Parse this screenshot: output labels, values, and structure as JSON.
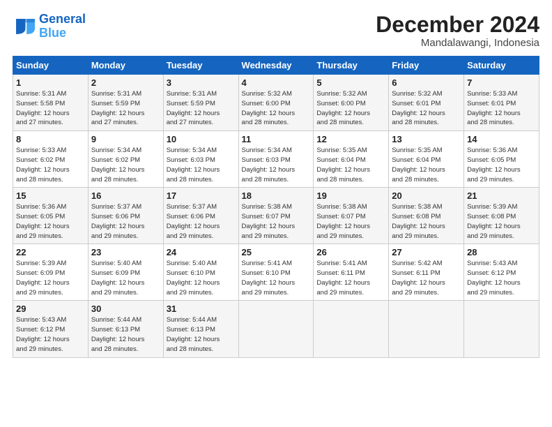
{
  "logo": {
    "line1": "General",
    "line2": "Blue"
  },
  "title": "December 2024",
  "location": "Mandalawangi, Indonesia",
  "days_header": [
    "Sunday",
    "Monday",
    "Tuesday",
    "Wednesday",
    "Thursday",
    "Friday",
    "Saturday"
  ],
  "weeks": [
    [
      {
        "num": "1",
        "info": "Sunrise: 5:31 AM\nSunset: 5:58 PM\nDaylight: 12 hours\nand 27 minutes."
      },
      {
        "num": "2",
        "info": "Sunrise: 5:31 AM\nSunset: 5:59 PM\nDaylight: 12 hours\nand 27 minutes."
      },
      {
        "num": "3",
        "info": "Sunrise: 5:31 AM\nSunset: 5:59 PM\nDaylight: 12 hours\nand 27 minutes."
      },
      {
        "num": "4",
        "info": "Sunrise: 5:32 AM\nSunset: 6:00 PM\nDaylight: 12 hours\nand 28 minutes."
      },
      {
        "num": "5",
        "info": "Sunrise: 5:32 AM\nSunset: 6:00 PM\nDaylight: 12 hours\nand 28 minutes."
      },
      {
        "num": "6",
        "info": "Sunrise: 5:32 AM\nSunset: 6:01 PM\nDaylight: 12 hours\nand 28 minutes."
      },
      {
        "num": "7",
        "info": "Sunrise: 5:33 AM\nSunset: 6:01 PM\nDaylight: 12 hours\nand 28 minutes."
      }
    ],
    [
      {
        "num": "8",
        "info": "Sunrise: 5:33 AM\nSunset: 6:02 PM\nDaylight: 12 hours\nand 28 minutes."
      },
      {
        "num": "9",
        "info": "Sunrise: 5:34 AM\nSunset: 6:02 PM\nDaylight: 12 hours\nand 28 minutes."
      },
      {
        "num": "10",
        "info": "Sunrise: 5:34 AM\nSunset: 6:03 PM\nDaylight: 12 hours\nand 28 minutes."
      },
      {
        "num": "11",
        "info": "Sunrise: 5:34 AM\nSunset: 6:03 PM\nDaylight: 12 hours\nand 28 minutes."
      },
      {
        "num": "12",
        "info": "Sunrise: 5:35 AM\nSunset: 6:04 PM\nDaylight: 12 hours\nand 28 minutes."
      },
      {
        "num": "13",
        "info": "Sunrise: 5:35 AM\nSunset: 6:04 PM\nDaylight: 12 hours\nand 28 minutes."
      },
      {
        "num": "14",
        "info": "Sunrise: 5:36 AM\nSunset: 6:05 PM\nDaylight: 12 hours\nand 29 minutes."
      }
    ],
    [
      {
        "num": "15",
        "info": "Sunrise: 5:36 AM\nSunset: 6:05 PM\nDaylight: 12 hours\nand 29 minutes."
      },
      {
        "num": "16",
        "info": "Sunrise: 5:37 AM\nSunset: 6:06 PM\nDaylight: 12 hours\nand 29 minutes."
      },
      {
        "num": "17",
        "info": "Sunrise: 5:37 AM\nSunset: 6:06 PM\nDaylight: 12 hours\nand 29 minutes."
      },
      {
        "num": "18",
        "info": "Sunrise: 5:38 AM\nSunset: 6:07 PM\nDaylight: 12 hours\nand 29 minutes."
      },
      {
        "num": "19",
        "info": "Sunrise: 5:38 AM\nSunset: 6:07 PM\nDaylight: 12 hours\nand 29 minutes."
      },
      {
        "num": "20",
        "info": "Sunrise: 5:38 AM\nSunset: 6:08 PM\nDaylight: 12 hours\nand 29 minutes."
      },
      {
        "num": "21",
        "info": "Sunrise: 5:39 AM\nSunset: 6:08 PM\nDaylight: 12 hours\nand 29 minutes."
      }
    ],
    [
      {
        "num": "22",
        "info": "Sunrise: 5:39 AM\nSunset: 6:09 PM\nDaylight: 12 hours\nand 29 minutes."
      },
      {
        "num": "23",
        "info": "Sunrise: 5:40 AM\nSunset: 6:09 PM\nDaylight: 12 hours\nand 29 minutes."
      },
      {
        "num": "24",
        "info": "Sunrise: 5:40 AM\nSunset: 6:10 PM\nDaylight: 12 hours\nand 29 minutes."
      },
      {
        "num": "25",
        "info": "Sunrise: 5:41 AM\nSunset: 6:10 PM\nDaylight: 12 hours\nand 29 minutes."
      },
      {
        "num": "26",
        "info": "Sunrise: 5:41 AM\nSunset: 6:11 PM\nDaylight: 12 hours\nand 29 minutes."
      },
      {
        "num": "27",
        "info": "Sunrise: 5:42 AM\nSunset: 6:11 PM\nDaylight: 12 hours\nand 29 minutes."
      },
      {
        "num": "28",
        "info": "Sunrise: 5:43 AM\nSunset: 6:12 PM\nDaylight: 12 hours\nand 29 minutes."
      }
    ],
    [
      {
        "num": "29",
        "info": "Sunrise: 5:43 AM\nSunset: 6:12 PM\nDaylight: 12 hours\nand 29 minutes."
      },
      {
        "num": "30",
        "info": "Sunrise: 5:44 AM\nSunset: 6:13 PM\nDaylight: 12 hours\nand 28 minutes."
      },
      {
        "num": "31",
        "info": "Sunrise: 5:44 AM\nSunset: 6:13 PM\nDaylight: 12 hours\nand 28 minutes."
      },
      null,
      null,
      null,
      null
    ]
  ]
}
